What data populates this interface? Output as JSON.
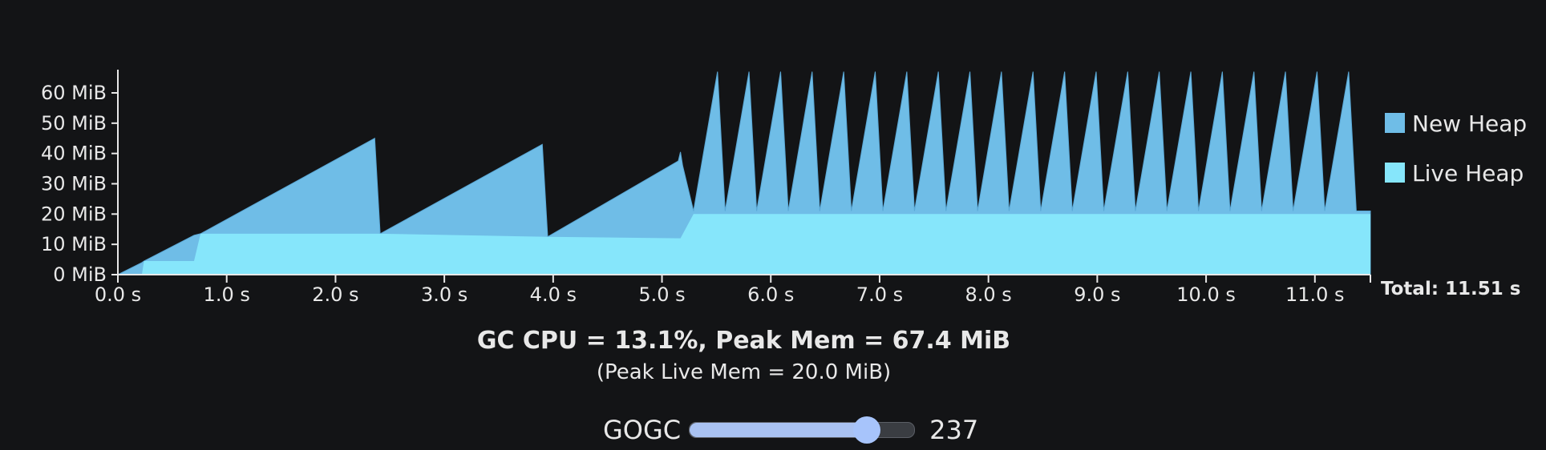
{
  "chart_data": {
    "type": "area",
    "x_unit": "s",
    "y_unit": "MiB",
    "xlim": [
      0,
      11.51
    ],
    "ylim": [
      0,
      67.4
    ],
    "x_ticks": [
      0,
      1,
      2,
      3,
      4,
      5,
      6,
      7,
      8,
      9,
      10,
      11
    ],
    "x_tick_labels": [
      "0.0 s",
      "1.0 s",
      "2.0 s",
      "3.0 s",
      "4.0 s",
      "5.0 s",
      "6.0 s",
      "7.0 s",
      "8.0 s",
      "9.0 s",
      "10.0 s",
      "11.0 s"
    ],
    "y_ticks": [
      0,
      10,
      20,
      30,
      40,
      50,
      60
    ],
    "y_tick_labels": [
      "0 MiB",
      "10 MiB",
      "20 MiB",
      "30 MiB",
      "40 MiB",
      "50 MiB",
      "60 MiB"
    ],
    "total_label": "Total: 11.51 s",
    "legend_position": "right",
    "series": [
      {
        "name": "New Heap",
        "color": "#6fbde7",
        "x": [
          0,
          0.22,
          0.22,
          0.24,
          0.7,
          0.76,
          2.36,
          2.41,
          3.9,
          3.95,
          5.15,
          5.17,
          5.19,
          5.29,
          5.51,
          5.58,
          5.8,
          5.87,
          6.09,
          6.16,
          6.38,
          6.45,
          6.67,
          6.74,
          6.96,
          7.03,
          7.25,
          7.32,
          7.54,
          7.61,
          7.83,
          7.9,
          8.12,
          8.19,
          8.41,
          8.48,
          8.7,
          8.77,
          8.99,
          9.06,
          9.28,
          9.35,
          9.57,
          9.64,
          9.86,
          9.93,
          10.15,
          10.22,
          10.44,
          10.51,
          10.73,
          10.8,
          11.02,
          11.09,
          11.31,
          11.38,
          11.51
        ],
        "y": [
          0,
          4,
          4,
          4.5,
          13,
          13.5,
          45,
          13.5,
          43,
          12.5,
          37.5,
          40.5,
          36,
          21,
          67,
          21,
          67,
          21,
          67,
          21,
          67,
          21,
          67,
          21,
          67,
          21,
          67,
          21,
          67,
          21,
          67,
          21,
          67,
          21,
          67,
          21,
          67,
          21,
          67,
          21,
          67,
          21,
          67,
          21,
          67,
          21,
          67,
          21,
          67,
          21,
          67,
          21,
          67,
          21,
          67,
          21,
          21
        ]
      },
      {
        "name": "Live Heap",
        "color": "#86e6fb",
        "x": [
          0,
          0.22,
          0.24,
          0.7,
          0.76,
          2.41,
          3.95,
          5.17,
          5.29,
          11.51
        ],
        "y": [
          0,
          0,
          4.5,
          4.5,
          13.5,
          13.5,
          12.5,
          12,
          20,
          20
        ]
      }
    ]
  },
  "summary": {
    "main": "GC CPU = 13.1%, Peak Mem = 67.4 MiB",
    "sub": "(Peak Live Mem = 20.0 MiB)"
  },
  "gogc": {
    "label": "GOGC",
    "value": "237",
    "min": 0,
    "max": 300
  }
}
